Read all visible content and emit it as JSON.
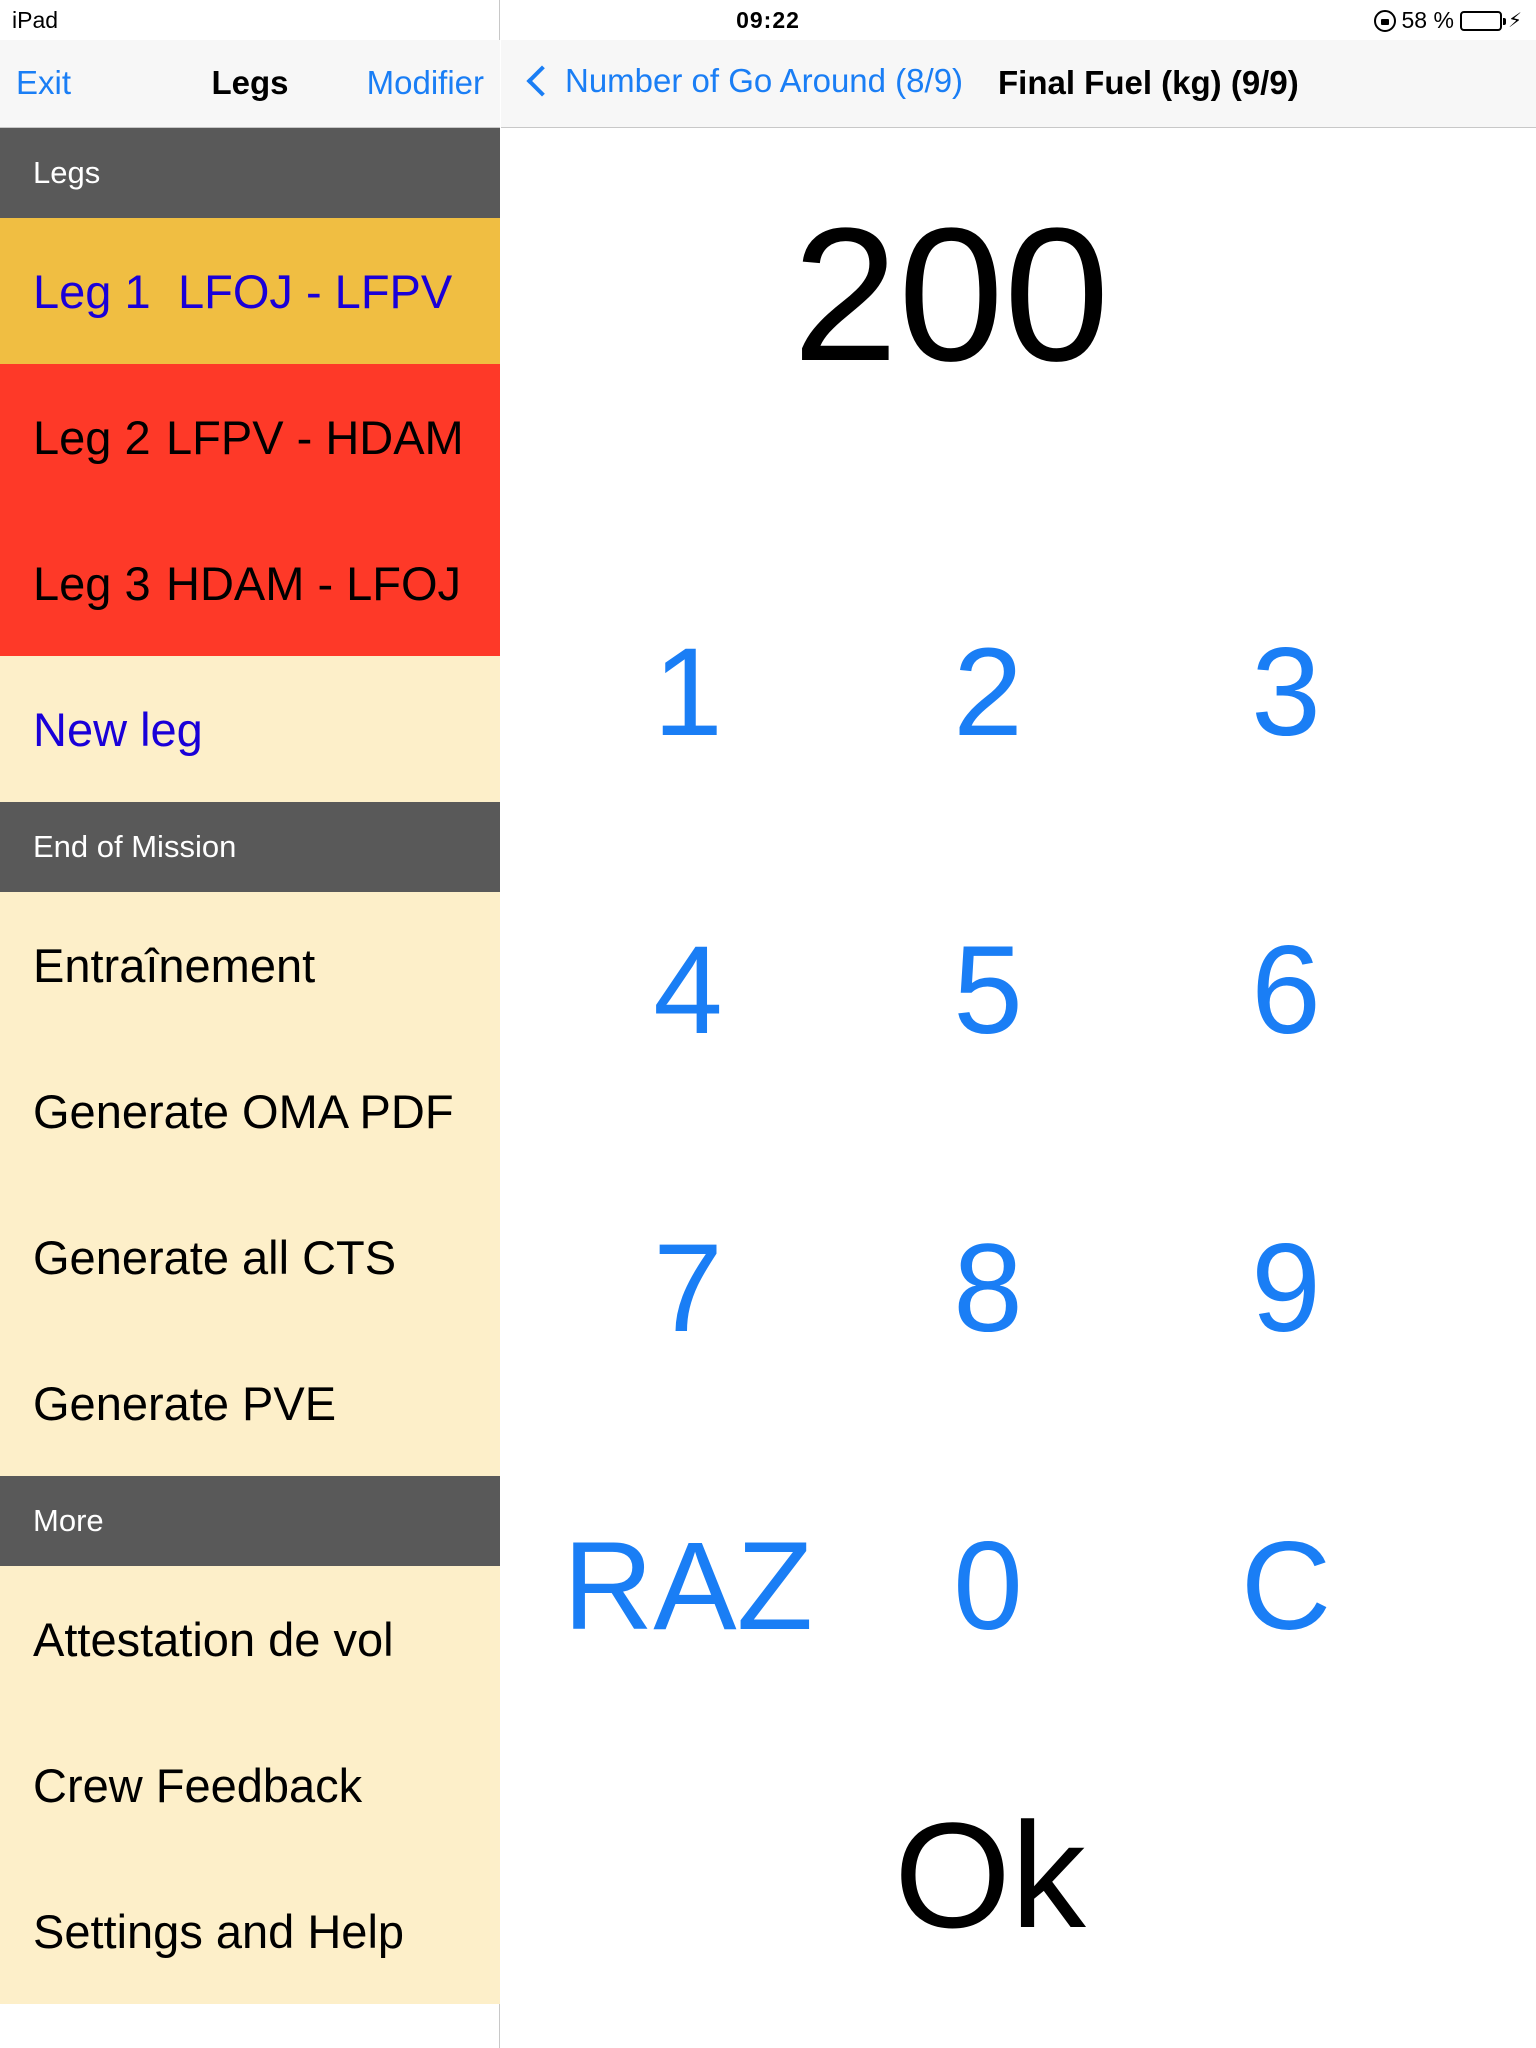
{
  "status_bar": {
    "device": "iPad",
    "time": "09:22",
    "battery_text": "58 %",
    "battery_level": 0.58,
    "icons": [
      "orientation-lock-icon",
      "battery-icon",
      "charging-bolt-icon"
    ]
  },
  "sidebar": {
    "nav": {
      "left_button": "Exit",
      "title": "Legs",
      "right_button": "Modifier"
    },
    "sections": {
      "legs": {
        "header": "Legs",
        "items": [
          {
            "num": "Leg 1",
            "route": "LFOJ - LFPV",
            "status": "current"
          },
          {
            "num": "Leg 2",
            "route": "LFPV - HDAM",
            "status": "alert"
          },
          {
            "num": "Leg 3",
            "route": "HDAM - LFOJ",
            "status": "alert"
          }
        ],
        "new_leg": "New leg"
      },
      "end_of_mission": {
        "header": "End of Mission",
        "items": [
          "Entraînement",
          "Generate OMA PDF",
          "Generate all CTS",
          "Generate PVE"
        ]
      },
      "more": {
        "header": "More",
        "items": [
          "Attestation de vol",
          "Crew Feedback",
          "Settings and Help"
        ]
      }
    },
    "colors": {
      "current_leg_bg": "#f0be42",
      "alert_leg_bg": "#fe3928",
      "row_bg": "#fdefc9",
      "header_bg": "#595959",
      "link_blue": "#1a00d8"
    }
  },
  "detail": {
    "nav": {
      "back_label": "Number of Go Around (8/9)",
      "title": "Final Fuel (kg) (9/9)"
    },
    "value": "200",
    "keys": [
      "1",
      "2",
      "3",
      "4",
      "5",
      "6",
      "7",
      "8",
      "9",
      "RAZ",
      "0",
      "C"
    ],
    "ok_label": "Ok",
    "accent": "#1a7ef5"
  }
}
